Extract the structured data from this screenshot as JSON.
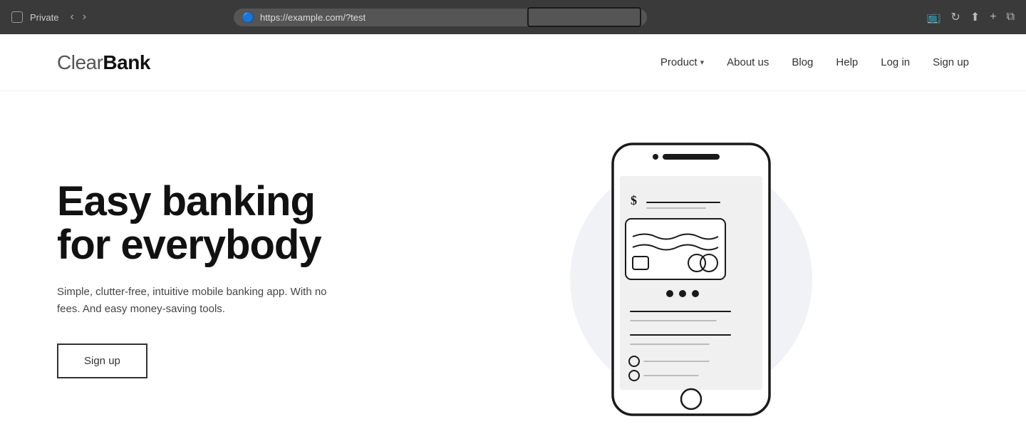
{
  "browser": {
    "tab_icon": "□",
    "private_label": "Private",
    "nav_back": "‹",
    "nav_forward": "›",
    "url": "https://example.com/?test",
    "secure_icon": "🔵",
    "share_icon": "⬆",
    "new_tab_icon": "+",
    "tabs_icon": "⧉",
    "media_icon": "▶",
    "refresh_icon": "↻"
  },
  "nav": {
    "logo_clear": "Clear",
    "logo_bank": "Bank",
    "product_label": "Product",
    "about_label": "About us",
    "blog_label": "Blog",
    "help_label": "Help",
    "login_label": "Log in",
    "signup_label": "Sign up"
  },
  "hero": {
    "title_line1": "Easy banking",
    "title_line2": "for everybody",
    "subtitle": "Simple, clutter-free, intuitive mobile banking app. With no fees. And easy money-saving tools.",
    "cta_label": "Sign up"
  }
}
